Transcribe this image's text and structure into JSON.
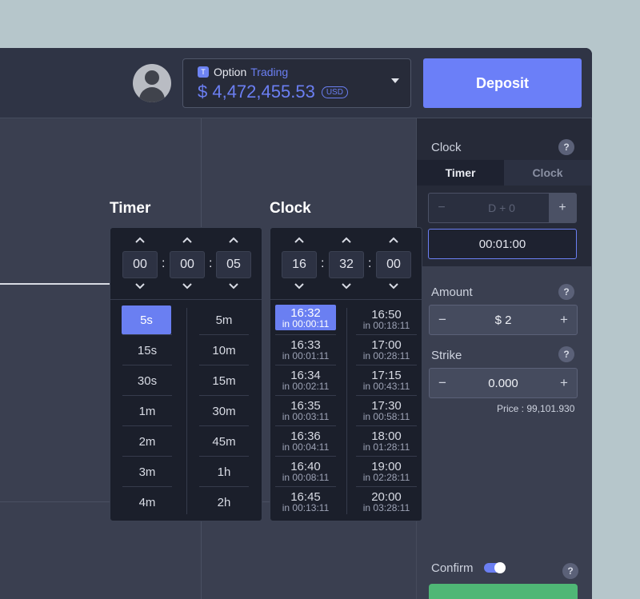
{
  "header": {
    "account_badge": "T",
    "account_prefix": "Option",
    "account_name": "Trading",
    "balance": "$ 4,472,455.53",
    "currency": "USD",
    "deposit_label": "Deposit"
  },
  "sidebar": {
    "mode_label": "Clock",
    "help": "?",
    "tabs": [
      "Timer",
      "Clock"
    ],
    "day_stepper": {
      "minus": "−",
      "value": "D + 0",
      "plus": "+"
    },
    "expiry_time": "00:01:00",
    "amount": {
      "label": "Amount",
      "minus": "−",
      "value": "$ 2",
      "plus": "+"
    },
    "strike": {
      "label": "Strike",
      "minus": "−",
      "value": "0.000",
      "plus": "+"
    },
    "price": "Price : 99,101.930",
    "confirm_label": "Confirm"
  },
  "timer_panel": {
    "title": "Timer",
    "spinners": [
      "00",
      "00",
      "05"
    ],
    "colon": ":",
    "left_options": [
      "5s",
      "15s",
      "30s",
      "1m",
      "2m",
      "3m",
      "4m"
    ],
    "right_options": [
      "5m",
      "10m",
      "15m",
      "30m",
      "45m",
      "1h",
      "2h"
    ],
    "selected": "5s"
  },
  "clock_panel": {
    "title": "Clock",
    "spinners": [
      "16",
      "32",
      "00"
    ],
    "colon": ":",
    "left_options": [
      {
        "time": "16:32",
        "in": "in 00:00:11"
      },
      {
        "time": "16:33",
        "in": "in 00:01:11"
      },
      {
        "time": "16:34",
        "in": "in 00:02:11"
      },
      {
        "time": "16:35",
        "in": "in 00:03:11"
      },
      {
        "time": "16:36",
        "in": "in 00:04:11"
      },
      {
        "time": "16:40",
        "in": "in 00:08:11"
      },
      {
        "time": "16:45",
        "in": "in 00:13:11"
      }
    ],
    "right_options": [
      {
        "time": "16:50",
        "in": "in 00:18:11"
      },
      {
        "time": "17:00",
        "in": "in 00:28:11"
      },
      {
        "time": "17:15",
        "in": "in 00:43:11"
      },
      {
        "time": "17:30",
        "in": "in 00:58:11"
      },
      {
        "time": "18:00",
        "in": "in 01:28:11"
      },
      {
        "time": "19:00",
        "in": "in 02:28:11"
      },
      {
        "time": "20:00",
        "in": "in 03:28:11"
      }
    ],
    "selected": "16:32"
  },
  "colors": {
    "accent": "#6b7ff8",
    "panel": "#1b1f2b",
    "app": "#3a3f50",
    "confirm_green": "#4fb776"
  }
}
